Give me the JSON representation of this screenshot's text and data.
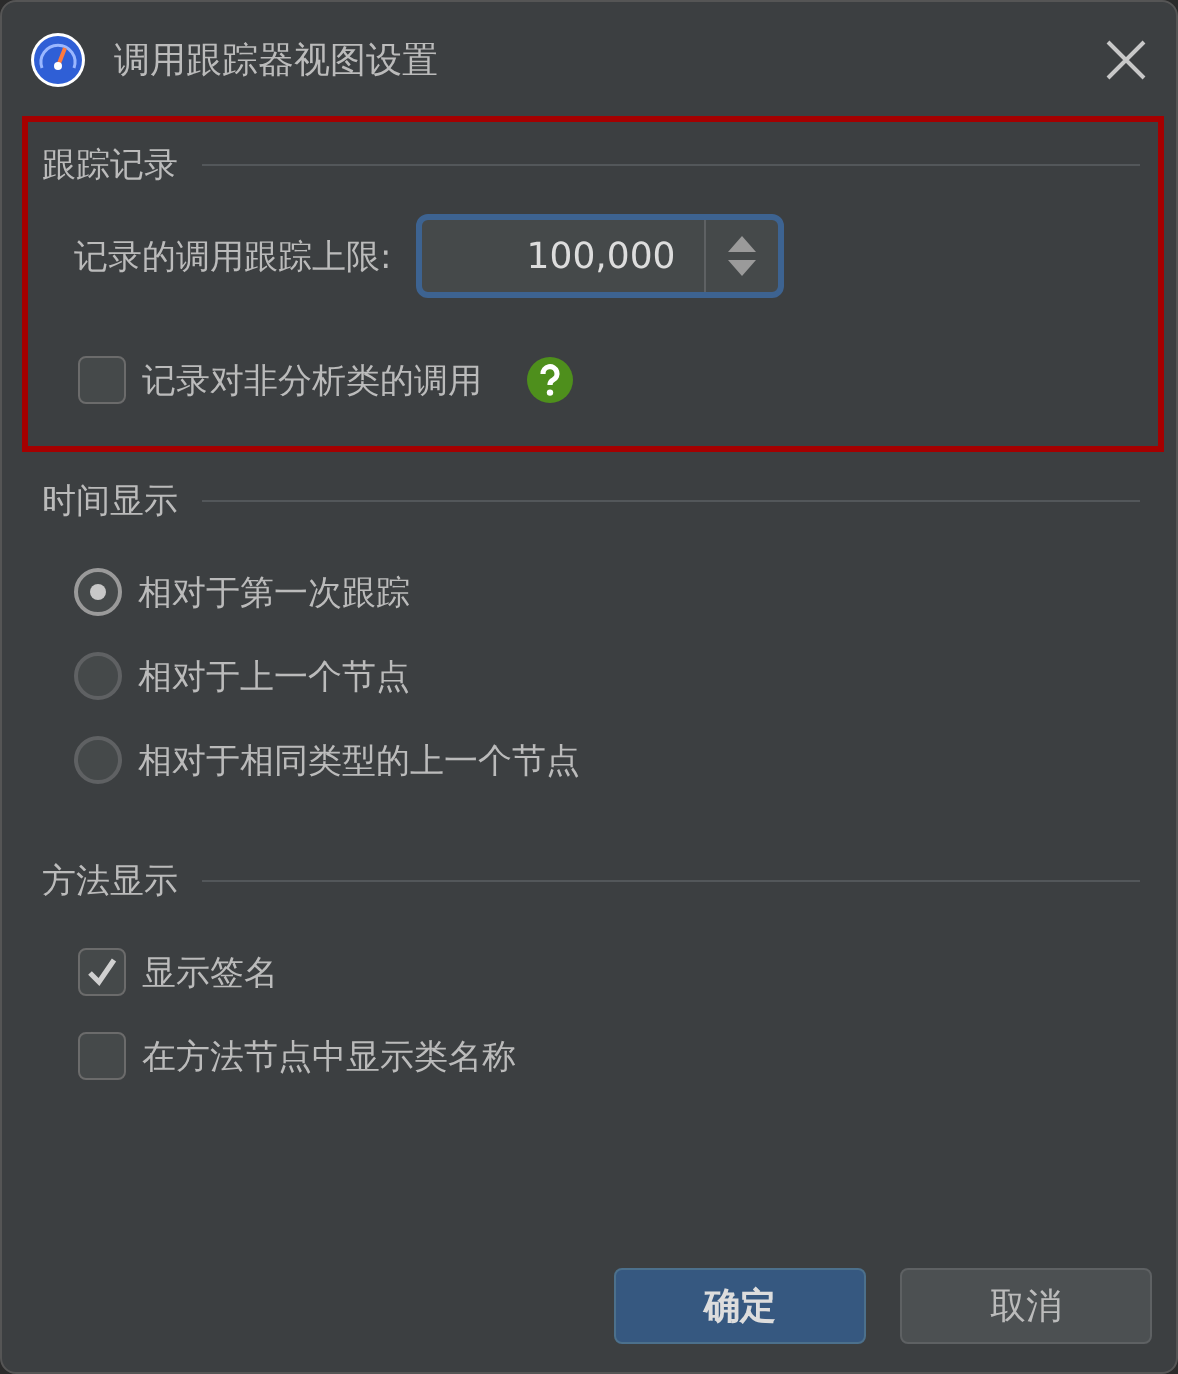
{
  "window": {
    "title": "调用跟踪器视图设置"
  },
  "sections": [
    {
      "title": "跟踪记录",
      "highlighted": true,
      "items": [
        {
          "kind": "spinner",
          "label": "记录的调用跟踪上限:",
          "value": "100,000"
        },
        {
          "kind": "checkbox",
          "label": "记录对非分析类的调用",
          "checked": false,
          "help": true
        }
      ]
    },
    {
      "title": "时间显示",
      "items": [
        {
          "kind": "radio",
          "label": "相对于第一次跟踪",
          "selected": true
        },
        {
          "kind": "radio",
          "label": "相对于上一个节点",
          "selected": false
        },
        {
          "kind": "radio",
          "label": "相对于相同类型的上一个节点",
          "selected": false
        }
      ]
    },
    {
      "title": "方法显示",
      "items": [
        {
          "kind": "checkbox",
          "label": "显示签名",
          "checked": true
        },
        {
          "kind": "checkbox",
          "label": "在方法节点中显示类名称",
          "checked": false
        }
      ]
    }
  ],
  "buttons": [
    {
      "label": "确定",
      "primary": true
    },
    {
      "label": "取消",
      "primary": false
    }
  ]
}
